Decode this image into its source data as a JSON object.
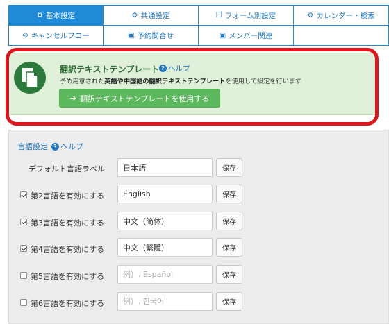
{
  "tabs": {
    "row1": [
      {
        "label": "基本設定",
        "icon": "gears-icon",
        "active": true
      },
      {
        "label": "共通設定",
        "icon": "gear-icon",
        "active": false
      },
      {
        "label": "フォーム別設定",
        "icon": "copy-icon",
        "active": false
      },
      {
        "label": "カレンダー・検索",
        "icon": "gear-icon",
        "active": false
      }
    ],
    "row2": [
      {
        "label": "キャンセルフロー",
        "icon": "ban-icon"
      },
      {
        "label": "予約問合せ",
        "icon": "id-card-icon"
      },
      {
        "label": "メンバー関連",
        "icon": "id-card-icon"
      }
    ]
  },
  "translation_card": {
    "title": "翻訳テキストテンプレート",
    "help_label": "ヘルプ",
    "desc_part1": "予め用意された",
    "desc_bold1": "英語や中国語の翻訳テキストテンプレート",
    "desc_part2": "を使用して設定を行います",
    "button_label": "翻訳テキストテンプレートを使用する",
    "colors": {
      "highlight": "#e0151b",
      "button": "#5cb85c",
      "badge": "#2c7a3c"
    }
  },
  "language_settings": {
    "title": "言語設定",
    "help_label": "ヘルプ",
    "save_label": "保存",
    "default_label": {
      "label": "デフォルト言語ラベル",
      "value": "日本語"
    },
    "rows": [
      {
        "label": "第2言語を有効にする",
        "checked": true,
        "value": "English",
        "placeholder": ""
      },
      {
        "label": "第3言語を有効にする",
        "checked": true,
        "value": "中文（简体）",
        "placeholder": ""
      },
      {
        "label": "第4言語を有効にする",
        "checked": true,
        "value": "中文（繁體）",
        "placeholder": ""
      },
      {
        "label": "第5言語を有効にする",
        "checked": false,
        "value": "",
        "placeholder": "例）. Español"
      },
      {
        "label": "第6言語を有効にする",
        "checked": false,
        "value": "",
        "placeholder": "例）. 한국어"
      }
    ]
  }
}
